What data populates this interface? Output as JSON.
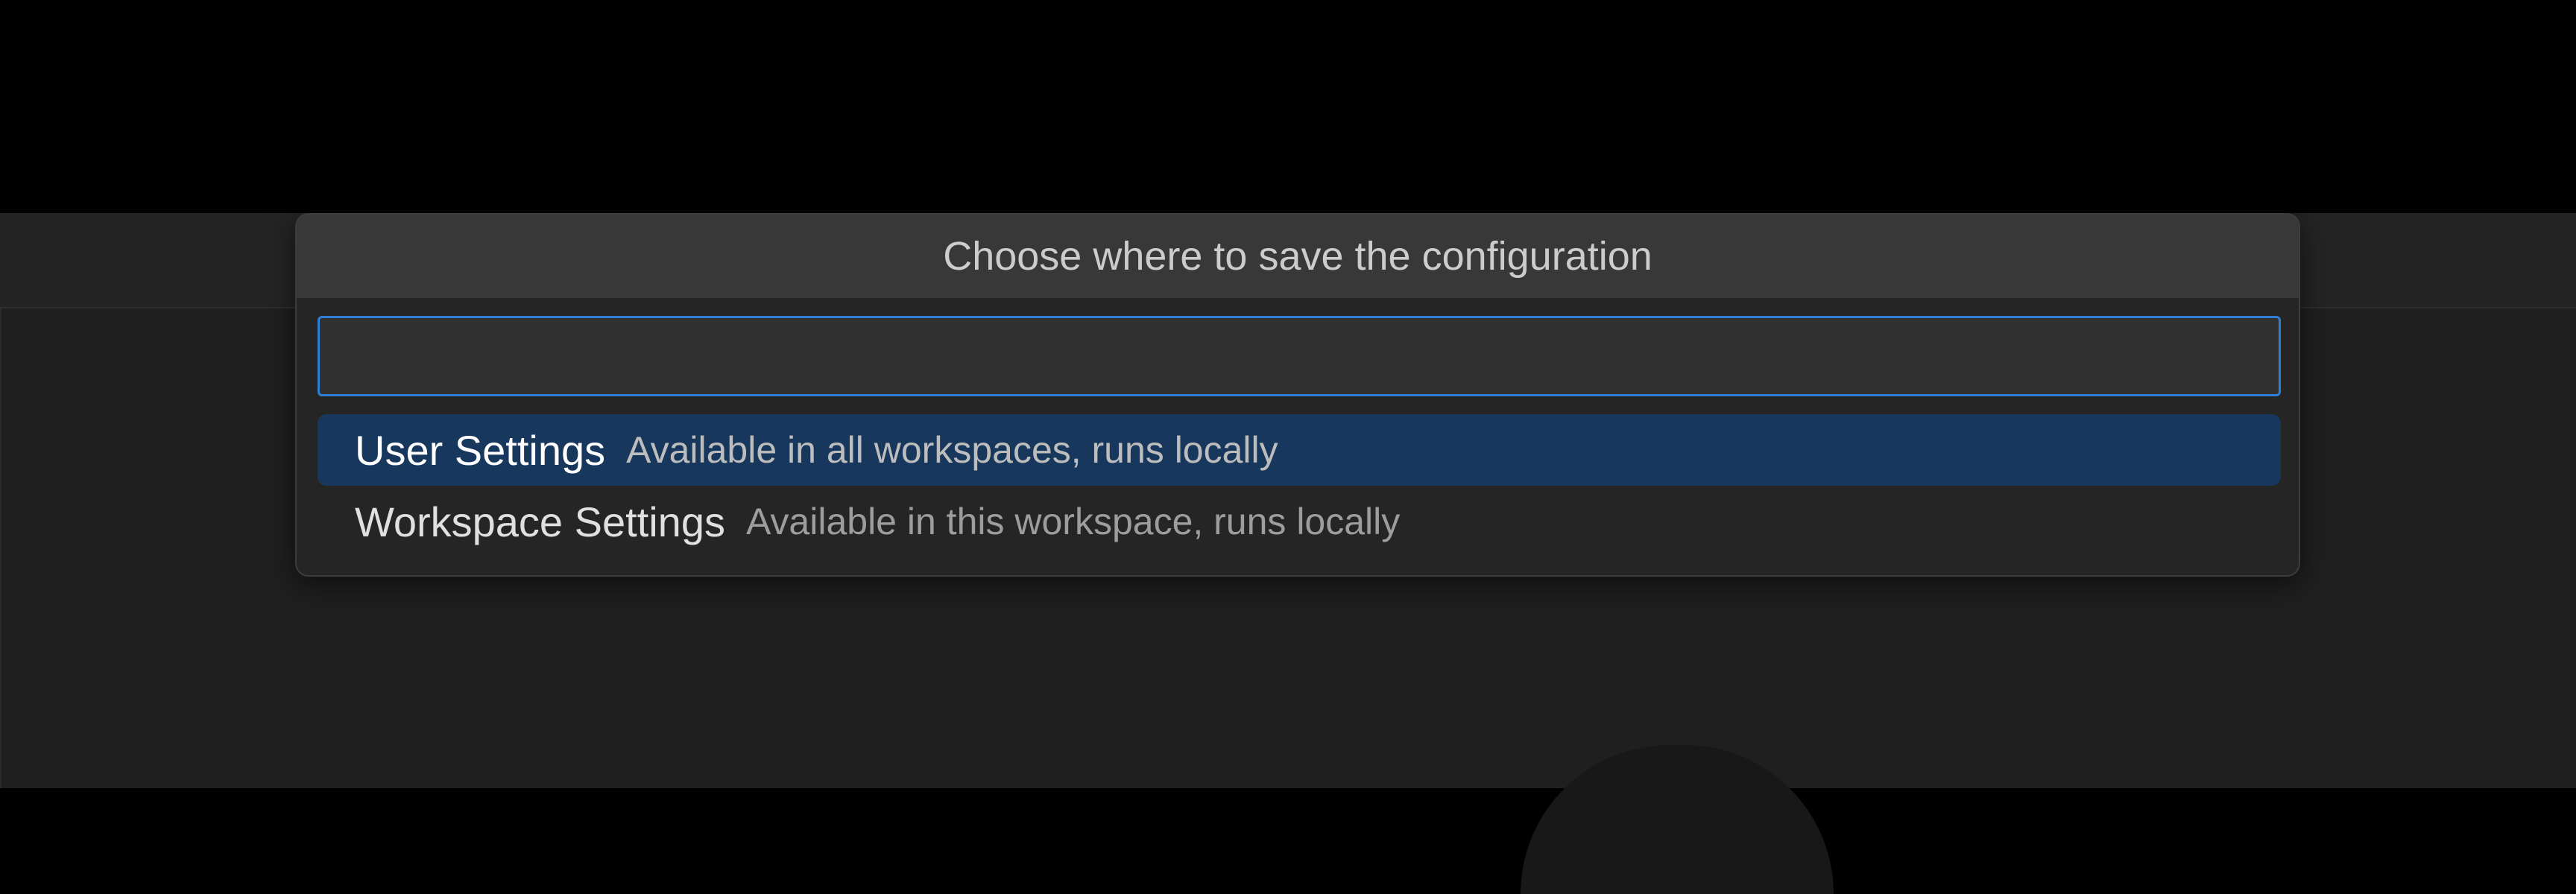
{
  "quick_pick": {
    "title": "Choose where to save the configuration",
    "input": {
      "value": "",
      "placeholder": ""
    },
    "items": [
      {
        "label": "User Settings",
        "description": "Available in all workspaces, runs locally",
        "selected": true
      },
      {
        "label": "Workspace Settings",
        "description": "Available in this workspace, runs locally",
        "selected": false
      }
    ]
  },
  "colors": {
    "selection": "#17375c",
    "focus_border": "#2f7fd6",
    "panel_bg": "#252525",
    "title_bg": "#383838"
  }
}
